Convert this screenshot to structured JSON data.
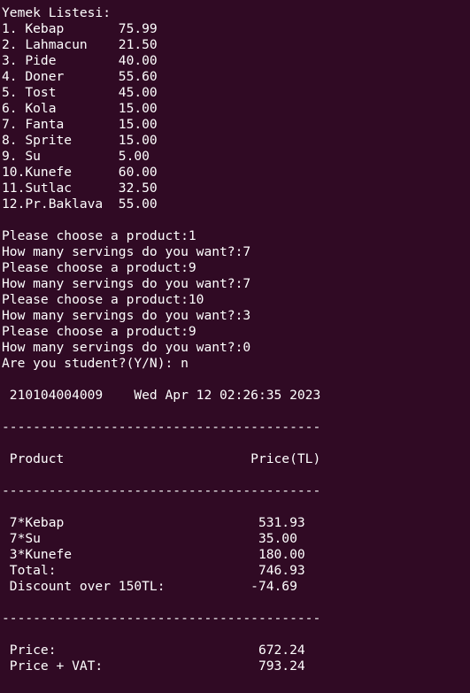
{
  "window": {
    "background_color": "#300a24",
    "text_color": "#ffffff"
  },
  "terminal_lines": [
    "Yemek Listesi:",
    "1. Kebap       75.99",
    "2. Lahmacun    21.50",
    "3. Pide        40.00",
    "4. Doner       55.60",
    "5. Tost        45.00",
    "6. Kola        15.00",
    "7. Fanta       15.00",
    "8. Sprite      15.00",
    "9. Su          5.00",
    "10.Kunefe      60.00",
    "11.Sutlac      32.50",
    "12.Pr.Baklava  55.00",
    "",
    "Please choose a product:1",
    "How many servings do you want?:7",
    "Please choose a product:9",
    "How many servings do you want?:7",
    "Please choose a product:10",
    "How many servings do you want?:3",
    "Please choose a product:9",
    "How many servings do you want?:0",
    "Are you student?(Y/N): n",
    "",
    " 210104004009    Wed Apr 12 02:26:35 2023",
    "",
    "-----------------------------------------",
    "",
    " Product                        Price(TL)",
    "",
    "-----------------------------------------",
    "",
    " 7*Kebap                         531.93",
    " 7*Su                            35.00",
    " 3*Kunefe                        180.00",
    " Total:                          746.93",
    " Discount over 150TL:           -74.69",
    "",
    "-----------------------------------------",
    "",
    " Price:                          672.24",
    " Price + VAT:                    793.24"
  ]
}
